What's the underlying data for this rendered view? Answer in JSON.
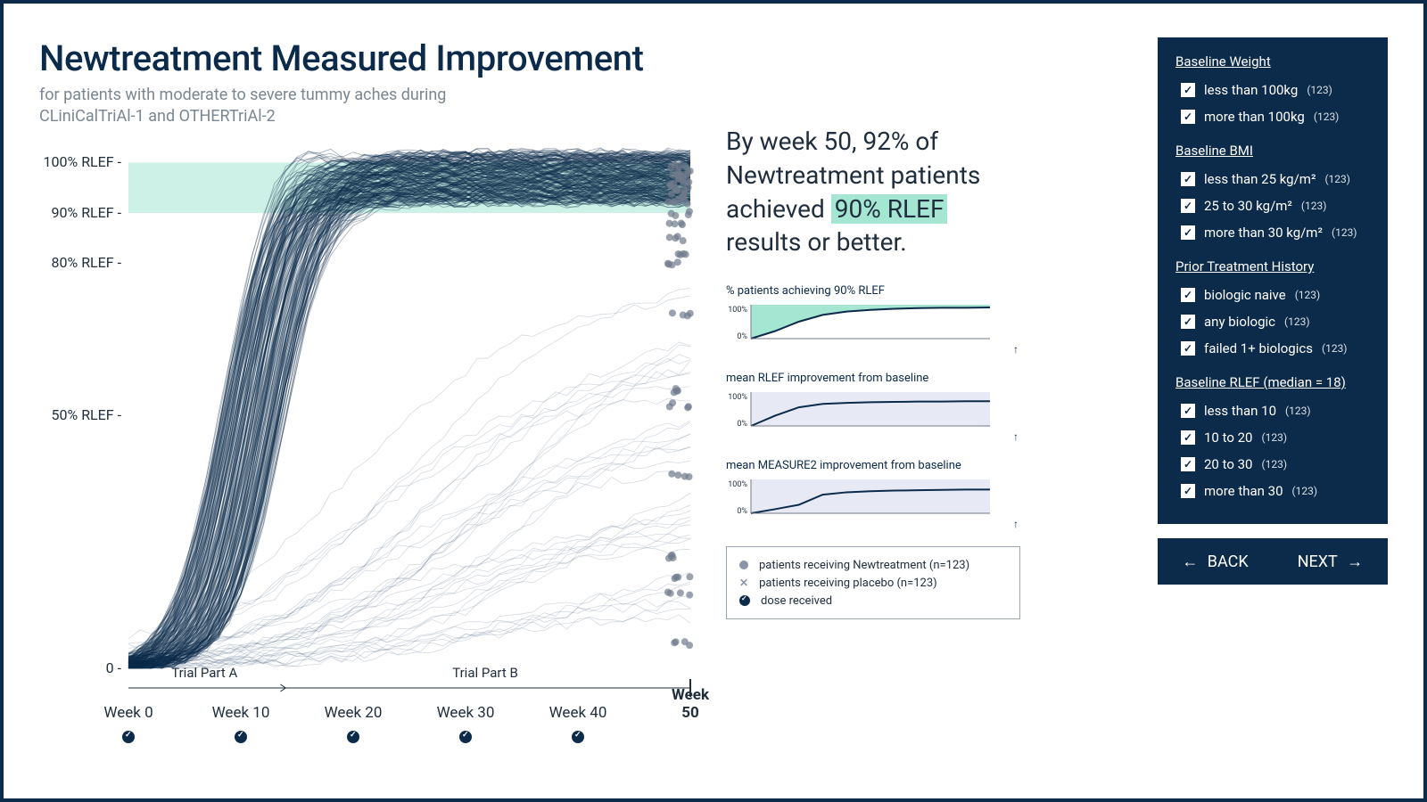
{
  "header": {
    "title": "Newtreatment Measured Improvement",
    "subtitle": "for patients with moderate to severe tummy aches during CLiniCalTriAl-1 and OTHERTriAl-2"
  },
  "chart_data": {
    "type": "line",
    "title": "Newtreatment Measured Improvement",
    "xlabel": "Week",
    "ylabel": "% RLEF",
    "x_ticks": [
      "Week 0",
      "Week 10",
      "Week 20",
      "Week 30",
      "Week 40",
      "Week 50"
    ],
    "y_ticks": [
      0,
      50,
      80,
      90,
      100
    ],
    "y_tick_labels": [
      "0 -",
      "50% RLEF -",
      "80% RLEF -",
      "90% RLEF -",
      "100% RLEF -"
    ],
    "ylim": [
      0,
      105
    ],
    "highlight_band": {
      "from": 90,
      "to": 100,
      "color": "#a5e6d3"
    },
    "phases": [
      {
        "label": "Trial Part A",
        "from_week": 0,
        "to_week": 14
      },
      {
        "label": "Trial Part B",
        "from_week": 14,
        "to_week": 50
      }
    ],
    "dose_markers_at_weeks": [
      0,
      10,
      20,
      30,
      40
    ],
    "note": "Spaghetti plot of ~246 individual patient RLEF trajectories from week 0 to 50; most rise steeply during weeks 0–12 and plateau in the 90–100% band; a minority stay low.",
    "series_summary": {
      "n_treatment": 123,
      "n_placebo": 123,
      "endpoints_week50_pct_rlef_sample": [
        99,
        98,
        98,
        97,
        96,
        95,
        94,
        93,
        92,
        90,
        88,
        85,
        82,
        80,
        70,
        55,
        52,
        38,
        22,
        18,
        15,
        5
      ]
    }
  },
  "headline": {
    "prefix": "By week 50, ",
    "pct": "92%",
    "mid": " of Newtreatment patients achieved ",
    "highlight": "90% RLEF",
    "suffix": " results or better."
  },
  "mini_charts": [
    {
      "title": "% patients achieving 90% RLEF",
      "ylim": [
        0,
        100
      ],
      "y_ticks": [
        "0%",
        "100%"
      ],
      "fill": "#a5e6d3",
      "x": [
        0,
        5,
        10,
        15,
        20,
        25,
        30,
        35,
        40,
        45,
        50
      ],
      "y": [
        0,
        22,
        50,
        70,
        80,
        85,
        88,
        90,
        91,
        91,
        92
      ]
    },
    {
      "title": "mean RLEF improvement from baseline",
      "ylim": [
        0,
        100
      ],
      "y_ticks": [
        "0%",
        "100%"
      ],
      "fill": "#e4e8f4",
      "x": [
        0,
        5,
        10,
        15,
        20,
        25,
        30,
        35,
        40,
        45,
        50
      ],
      "y": [
        0,
        30,
        55,
        65,
        68,
        70,
        71,
        72,
        72,
        73,
        73
      ]
    },
    {
      "title": "mean MEASURE2 improvement from baseline",
      "ylim": [
        0,
        100
      ],
      "y_ticks": [
        "0%",
        "100%"
      ],
      "fill": "#e4e8f4",
      "x": [
        0,
        5,
        10,
        15,
        20,
        25,
        30,
        35,
        40,
        45,
        50
      ],
      "y": [
        0,
        12,
        25,
        55,
        62,
        65,
        67,
        68,
        69,
        70,
        70
      ]
    }
  ],
  "legend": {
    "treatment": "patients receiving Newtreatment (n=123)",
    "placebo": "patients receiving placebo (n=123)",
    "dose": "dose received"
  },
  "filters": {
    "groups": [
      {
        "title": "Baseline Weight",
        "items": [
          {
            "label": "less than 100kg",
            "count": 123,
            "checked": true
          },
          {
            "label": "more than 100kg",
            "count": 123,
            "checked": true
          }
        ]
      },
      {
        "title": "Baseline BMI",
        "items": [
          {
            "label": "less than 25 kg/m²",
            "count": 123,
            "checked": true
          },
          {
            "label": "25 to 30 kg/m²",
            "count": 123,
            "checked": true
          },
          {
            "label": "more than 30 kg/m²",
            "count": 123,
            "checked": true
          }
        ]
      },
      {
        "title": "Prior Treatment History",
        "items": [
          {
            "label": "biologic naive",
            "count": 123,
            "checked": true
          },
          {
            "label": "any biologic",
            "count": 123,
            "checked": true
          },
          {
            "label": "failed 1+ biologics",
            "count": 123,
            "checked": true
          }
        ]
      },
      {
        "title": "Baseline RLEF (median = 18)",
        "items": [
          {
            "label": "less than 10",
            "count": 123,
            "checked": true
          },
          {
            "label": "10 to 20",
            "count": 123,
            "checked": true
          },
          {
            "label": "20 to 30",
            "count": 123,
            "checked": true
          },
          {
            "label": "more than 30",
            "count": 123,
            "checked": true
          }
        ]
      }
    ]
  },
  "nav": {
    "back": "BACK",
    "next": "NEXT"
  }
}
